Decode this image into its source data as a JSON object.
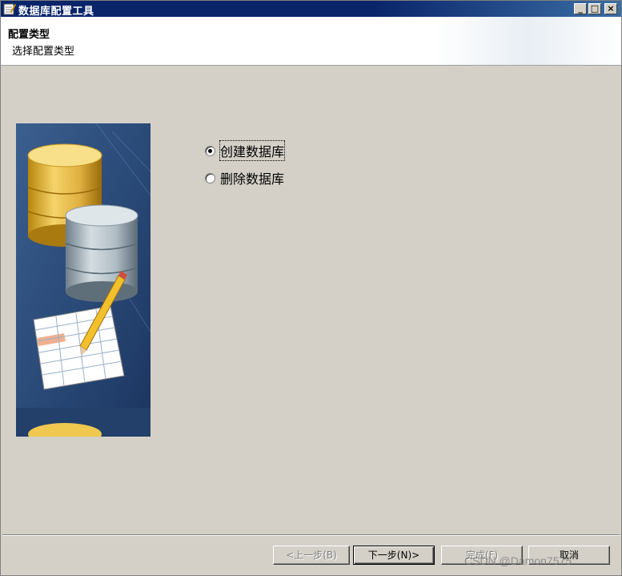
{
  "window": {
    "title": "数据库配置工具",
    "minimize_label": "_",
    "maximize_label": "□",
    "close_label": "×"
  },
  "header": {
    "title": "配置类型",
    "subtitle": "选择配置类型"
  },
  "options": [
    {
      "label": "创建数据库",
      "checked": true
    },
    {
      "label": "删除数据库",
      "checked": false
    }
  ],
  "buttons": {
    "back": "<上一步(B)",
    "next": "下一步(N)>",
    "finish": "完成(F)",
    "cancel": "取消"
  },
  "watermark": "CSDN @Damon7575",
  "colors": {
    "titlebar": "#0a246a",
    "background": "#d4d0c8"
  }
}
